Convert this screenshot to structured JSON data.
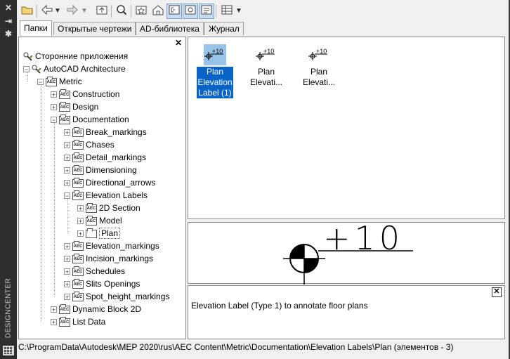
{
  "sidebar": {
    "close_glyph": "✕",
    "pin_glyph": "⇥",
    "props_glyph": "✱",
    "vertical_title": "DESIGNCENTER"
  },
  "toolbar": {
    "buttons": [
      {
        "name": "load-button",
        "glyph": "📂"
      },
      {
        "name": "back-button",
        "glyph": "⇦"
      },
      {
        "name": "back-dropdown",
        "glyph": "▾"
      },
      {
        "name": "forward-button",
        "glyph": "⇨"
      },
      {
        "name": "forward-dropdown",
        "glyph": "▾"
      },
      {
        "name": "up-button",
        "glyph": "⬆"
      },
      {
        "name": "search-button",
        "glyph": "🔍"
      },
      {
        "name": "favorites-button",
        "glyph": "☆"
      },
      {
        "name": "home-button",
        "glyph": "⌂"
      },
      {
        "name": "tree-toggle-button",
        "glyph": "☷"
      },
      {
        "name": "preview-button",
        "glyph": "▣"
      },
      {
        "name": "description-button",
        "glyph": "≡"
      },
      {
        "name": "views-button",
        "glyph": "▤"
      },
      {
        "name": "views-dropdown",
        "glyph": "▾"
      }
    ]
  },
  "tabs": [
    {
      "label": "Папки"
    },
    {
      "label": "Открытые чертежи"
    },
    {
      "label": "AD-библиотека"
    },
    {
      "label": "Журнал"
    }
  ],
  "tree": {
    "close_glyph": "✕",
    "nodes": [
      {
        "label": "Сторонние приложения",
        "icon": "app-icon",
        "expander": "",
        "level": 0
      },
      {
        "label": "AutoCAD Architecture",
        "icon": "app-icon",
        "expander": "−",
        "level": 1
      },
      {
        "label": "Metric",
        "icon": "aec-folder-icon",
        "expander": "−",
        "level": 2
      },
      {
        "label": "Construction",
        "icon": "aec-folder-icon",
        "expander": "+",
        "level": 3
      },
      {
        "label": "Design",
        "icon": "aec-folder-icon",
        "expander": "+",
        "level": 3
      },
      {
        "label": "Documentation",
        "icon": "aec-folder-icon",
        "expander": "−",
        "level": 3
      },
      {
        "label": "Break_markings",
        "icon": "aec-folder-icon",
        "expander": "+",
        "level": 4
      },
      {
        "label": "Chases",
        "icon": "aec-folder-icon",
        "expander": "+",
        "level": 4
      },
      {
        "label": "Detail_markings",
        "icon": "aec-folder-icon",
        "expander": "+",
        "level": 4
      },
      {
        "label": "Dimensioning",
        "icon": "aec-folder-icon",
        "expander": "+",
        "level": 4
      },
      {
        "label": "Directional_arrows",
        "icon": "aec-folder-icon",
        "expander": "+",
        "level": 4
      },
      {
        "label": "Elevation Labels",
        "icon": "aec-folder-icon",
        "expander": "−",
        "level": 4
      },
      {
        "label": "2D Section",
        "icon": "aec-folder-icon",
        "expander": "+",
        "level": 5
      },
      {
        "label": "Model",
        "icon": "aec-folder-icon",
        "expander": "+",
        "level": 5
      },
      {
        "label": "Plan",
        "icon": "folder-icon",
        "expander": "+",
        "level": 5,
        "selected": true
      },
      {
        "label": "Elevation_markings",
        "icon": "aec-folder-icon",
        "expander": "+",
        "level": 4
      },
      {
        "label": "Incision_markings",
        "icon": "aec-folder-icon",
        "expander": "+",
        "level": 4
      },
      {
        "label": "Schedules",
        "icon": "aec-folder-icon",
        "expander": "+",
        "level": 4
      },
      {
        "label": "Slits Openings",
        "icon": "aec-folder-icon",
        "expander": "+",
        "level": 4
      },
      {
        "label": "Spot_height_markings",
        "icon": "aec-folder-icon",
        "expander": "+",
        "level": 4
      },
      {
        "label": "Dynamic Block 2D",
        "icon": "aec-folder-icon",
        "expander": "+",
        "level": 3
      },
      {
        "label": "List Data",
        "icon": "aec-folder-icon",
        "expander": "+",
        "level": 3
      }
    ]
  },
  "content": {
    "items": [
      {
        "line1": "Plan",
        "line2": "Elevation",
        "line3": "Label (1)",
        "thumb_text": "+10",
        "selected": true
      },
      {
        "line1": "Plan",
        "line2": "Elevati...",
        "line3": "",
        "thumb_text": "+10",
        "selected": false
      },
      {
        "line1": "Plan",
        "line2": "Elevati...",
        "line3": "",
        "thumb_text": "+10",
        "selected": false
      }
    ]
  },
  "preview": {
    "label_text": "+10"
  },
  "description": {
    "close_glyph": "✕",
    "text": "Elevation Label (Type 1) to annotate floor plans"
  },
  "status": {
    "path": "C:\\ProgramData\\Autodesk\\MEP 2020\\rus\\AEC Content\\Metric\\Documentation\\Elevation Labels\\Plan (элементов  - 3)"
  }
}
